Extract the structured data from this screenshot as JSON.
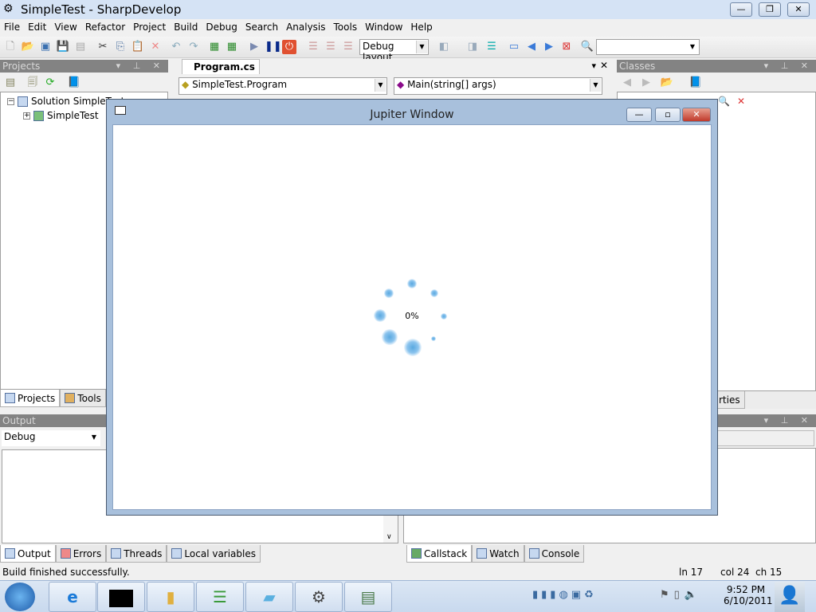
{
  "app": {
    "title": "SimpleTest - SharpDevelop"
  },
  "menu": [
    "File",
    "Edit",
    "View",
    "Refactor",
    "Project",
    "Build",
    "Debug",
    "Search",
    "Analysis",
    "Tools",
    "Window",
    "Help"
  ],
  "toolbar": {
    "layout_combo": "Debug layout",
    "search_value": ""
  },
  "projects": {
    "title": "Projects",
    "tree": [
      {
        "label": "Solution SimpleTest"
      },
      {
        "label": "SimpleTest"
      }
    ],
    "tabs": [
      "Projects",
      "Tools"
    ]
  },
  "editor": {
    "tab": "Program.cs",
    "class_combo": "SimpleTest.Program",
    "member_combo": "Main(string[] args)"
  },
  "classes": {
    "title": "Classes",
    "tabs_partial": "rties"
  },
  "output": {
    "title": "Output",
    "category": "Debug",
    "tabs": [
      "Output",
      "Errors",
      "Threads",
      "Local variables"
    ]
  },
  "debug_tabs": [
    "Callstack",
    "Watch",
    "Console"
  ],
  "jupiter": {
    "title": "Jupiter Window",
    "progress_label": "0%",
    "progress": 0
  },
  "status": {
    "message": "Build finished successfully.",
    "line": "ln 17",
    "col": "col 24",
    "ch": "ch 15"
  },
  "taskbar": {
    "time": "9:52 PM",
    "date": "6/10/2011",
    "apps": [
      "internet-explorer",
      "command-prompt",
      "windows-explorer",
      "task-list",
      "notepad",
      "sharpdevelop",
      "window-app"
    ]
  },
  "colors": {
    "panel_header": "#838383",
    "jupiter_frame": "#a8c0dc",
    "spinner": "#5aa9e0"
  }
}
